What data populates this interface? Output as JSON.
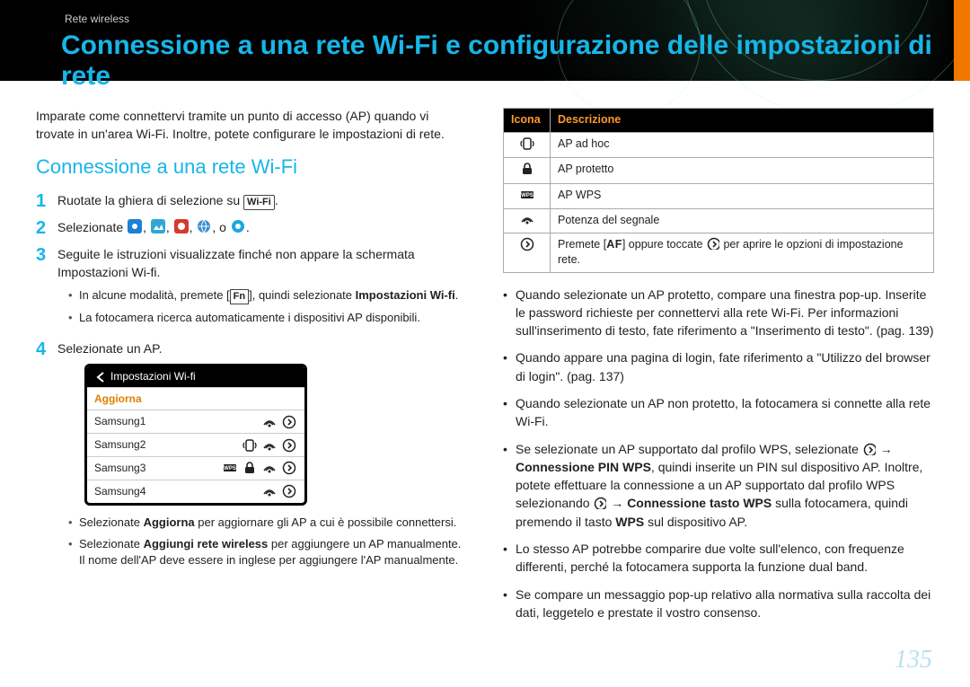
{
  "breadcrumb": "Rete wireless",
  "title": "Connessione a una rete Wi-Fi e configurazione delle impostazioni di rete",
  "intro": "Imparate come connettervi tramite un punto di accesso (AP) quando vi trovate in un'area Wi-Fi. Inoltre, potete configurare le impostazioni di rete.",
  "section_title": "Connessione a una rete Wi-Fi",
  "steps": {
    "1": "Ruotate la ghiera di selezione su ",
    "1_wifi": "Wi-Fi",
    "2_a": "Selezionate ",
    "2_b": ", o ",
    "3_a": "Seguite le istruzioni visualizzate finché non appare la schermata Impostazioni Wi-fi.",
    "3_sub1_a": "In alcune modalità, premete [",
    "3_sub1_fn": "Fn",
    "3_sub1_b": "], quindi selezionate ",
    "3_sub1_c": "Impostazioni Wi-fi",
    "3_sub2": "La fotocamera ricerca automaticamente i dispositivi AP disponibili.",
    "4": "Selezionate un AP."
  },
  "device": {
    "title": "Impostazioni Wi-fi",
    "refresh": "Aggiorna",
    "rows": [
      "Samsung1",
      "Samsung2",
      "Samsung3",
      "Samsung4"
    ]
  },
  "step4_sub": {
    "a_pre": "Selezionate ",
    "a_bold": "Aggiorna",
    "a_post": " per aggiornare gli AP a cui è possibile connettersi.",
    "b_pre": "Selezionate ",
    "b_bold": "Aggiungi rete wireless",
    "b_post": " per aggiungere un AP manualmente. Il nome dell'AP deve essere in inglese per aggiungere l'AP manualmente."
  },
  "table": {
    "h1": "Icona",
    "h2": "Descrizione",
    "rows": [
      "AP ad hoc",
      "AP protetto",
      "AP WPS",
      "Potenza del segnale"
    ],
    "r5_a": "Premete [",
    "r5_af": "AF",
    "r5_b": "] oppure toccate ",
    "r5_c": " per aprire le opzioni di impostazione rete."
  },
  "bullets": {
    "b1": "Quando selezionate un AP protetto, compare una finestra pop-up. Inserite le password richieste per connettervi alla rete Wi-Fi. Per informazioni sull'inserimento di testo, fate riferimento a \"Inserimento di testo\". (pag. 139)",
    "b2": "Quando appare una pagina di login, fate riferimento a \"Utilizzo del browser di login\". (pag. 137)",
    "b3": "Quando selezionate un AP non protetto, la fotocamera si connette alla rete Wi-Fi.",
    "b4_a": "Se selezionate un AP supportato dal profilo WPS, selezionate ",
    "b4_b": " → ",
    "b4_bold1": "Connessione PIN WPS",
    "b4_c": ", quindi inserite un PIN sul dispositivo AP. Inoltre, potete effettuare la connessione a un AP supportato dal profilo WPS selezionando ",
    "b4_d": " → ",
    "b4_bold2": "Connessione tasto WPS",
    "b4_e": " sulla fotocamera, quindi premendo il tasto ",
    "b4_bold3": "WPS",
    "b4_f": " sul dispositivo AP.",
    "b5": "Lo stesso AP potrebbe comparire due volte sull'elenco, con frequenze differenti, perché la fotocamera supporta la funzione dual band.",
    "b6": "Se compare un messaggio pop-up relativo alla normativa sulla raccolta dei dati, leggetelo e prestate il vostro consenso."
  },
  "page_number": "135"
}
